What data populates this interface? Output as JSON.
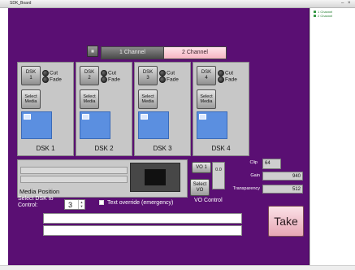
{
  "window": {
    "title": "SDK_Board",
    "controls": [
      "–",
      "×"
    ]
  },
  "side_tree": {
    "items": [
      "1 Channel",
      "2 Channel"
    ]
  },
  "channel_bar": {
    "icon": "channel-icon",
    "tabs": [
      {
        "label": "1 Channel",
        "selected": false
      },
      {
        "label": "2 Channel",
        "selected": true
      }
    ]
  },
  "dsk_panels": [
    {
      "button_label": [
        "DSK",
        "1"
      ],
      "cut_label": "Cut",
      "fade_label": "Fade",
      "select_media_label": [
        "Select",
        "Media"
      ],
      "label": "DSK 1"
    },
    {
      "button_label": [
        "DSK",
        "2"
      ],
      "cut_label": "Cut",
      "fade_label": "Fade",
      "select_media_label": [
        "Select",
        "Media"
      ],
      "label": "DSK 2"
    },
    {
      "button_label": [
        "DSK",
        "3"
      ],
      "cut_label": "Cut",
      "fade_label": "Fade",
      "select_media_label": [
        "Select",
        "Media"
      ],
      "label": "DSK 3"
    },
    {
      "button_label": [
        "DSK",
        "4"
      ],
      "cut_label": "Cut",
      "fade_label": "Fade",
      "select_media_label": [
        "Select",
        "Media"
      ],
      "label": "DSK 4"
    }
  ],
  "media": {
    "label": "Media Position"
  },
  "vo": {
    "vo_button": "VO 1",
    "select_vo": [
      "Select",
      "VO"
    ],
    "value": "0.0",
    "control_label": "VO Control"
  },
  "right_controls": {
    "clip_label": "Clip",
    "clip_value": "64",
    "gain_label": "Gain",
    "gain_value": "940",
    "transparency_label": "Transparency",
    "transparency_value": "512"
  },
  "bottom": {
    "select_label": [
      "Select DSK to",
      "Control:"
    ],
    "select_value": "3",
    "override_label": "Text override (emergency)",
    "override_checked": false,
    "take_label": "Take"
  }
}
